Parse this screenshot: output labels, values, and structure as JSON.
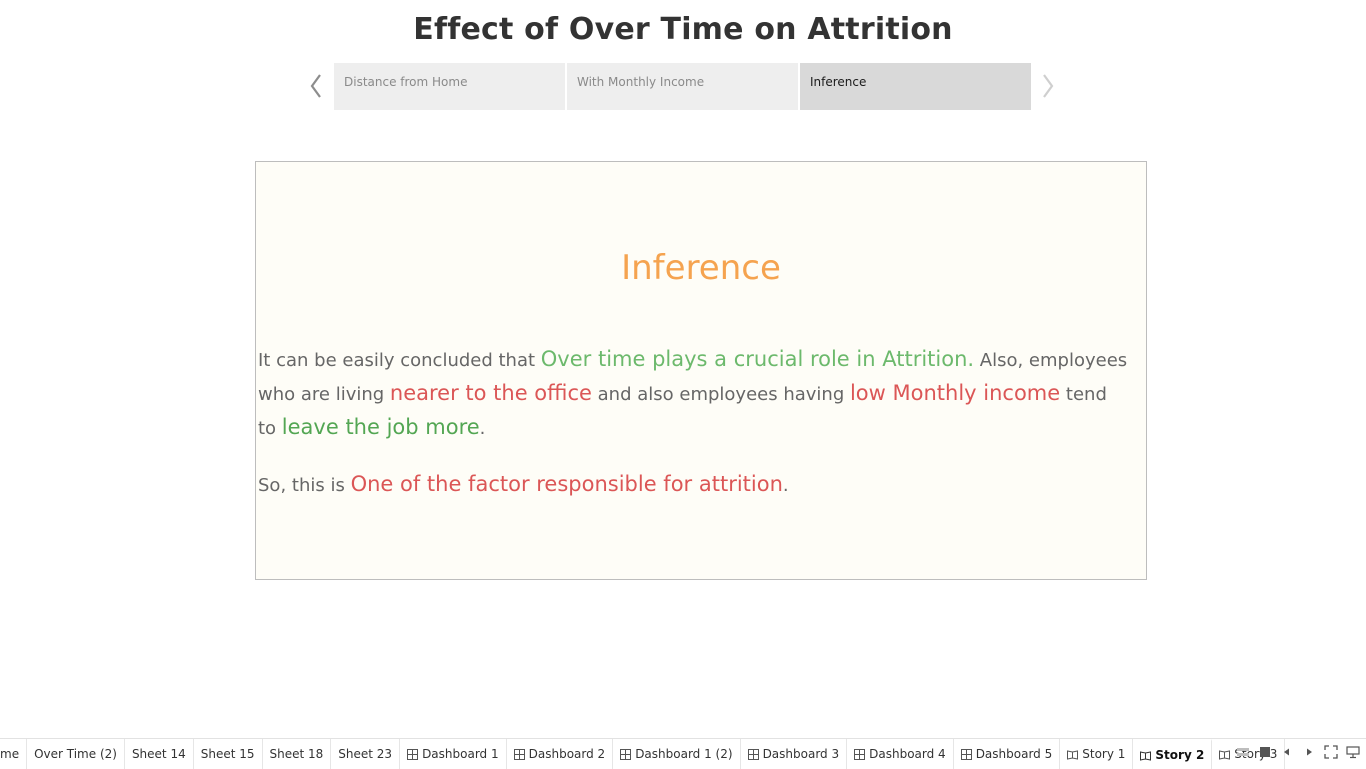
{
  "story": {
    "title": "Effect of Over Time on Attrition",
    "points": [
      "Distance from Home",
      "With Monthly Income",
      "Inference"
    ],
    "active_point": "Inference"
  },
  "inference": {
    "heading": "Inference",
    "p1": {
      "t1": "It can be easily concluded that ",
      "h1": "Over time plays a crucial role in Attrition.",
      "t2": " Also, employees",
      "t3": "who are living ",
      "h2": "nearer to the office",
      "t4": " and also employees having ",
      "h3": "low Monthly income",
      "t5": " tend",
      "t6": "to ",
      "h4": "leave the job more",
      "t7": "."
    },
    "p2": {
      "t1": "So, this is ",
      "h1": "One of the factor responsible for attrition",
      "t2": "."
    }
  },
  "colors": {
    "heading": "#f5a34f",
    "green_highlight": "#6cb96c",
    "red_highlight": "#db5656",
    "box_background": "#fefdf7"
  },
  "tabs": [
    {
      "label": "me",
      "icon": "none"
    },
    {
      "label": "Over Time (2)",
      "icon": "none"
    },
    {
      "label": "Sheet 14",
      "icon": "none"
    },
    {
      "label": "Sheet 15",
      "icon": "none"
    },
    {
      "label": "Sheet 18",
      "icon": "none"
    },
    {
      "label": "Sheet 23",
      "icon": "none"
    },
    {
      "label": "Dashboard 1",
      "icon": "dashboard-icon"
    },
    {
      "label": "Dashboard 2",
      "icon": "dashboard-icon"
    },
    {
      "label": "Dashboard 1 (2)",
      "icon": "dashboard-icon"
    },
    {
      "label": "Dashboard 3",
      "icon": "dashboard-icon"
    },
    {
      "label": "Dashboard 4",
      "icon": "dashboard-icon"
    },
    {
      "label": "Dashboard 5",
      "icon": "dashboard-icon"
    },
    {
      "label": "Story 1",
      "icon": "story-icon"
    },
    {
      "label": "Story 2",
      "icon": "story-icon",
      "active": true
    },
    {
      "label": "Story 3",
      "icon": "story-icon"
    }
  ]
}
